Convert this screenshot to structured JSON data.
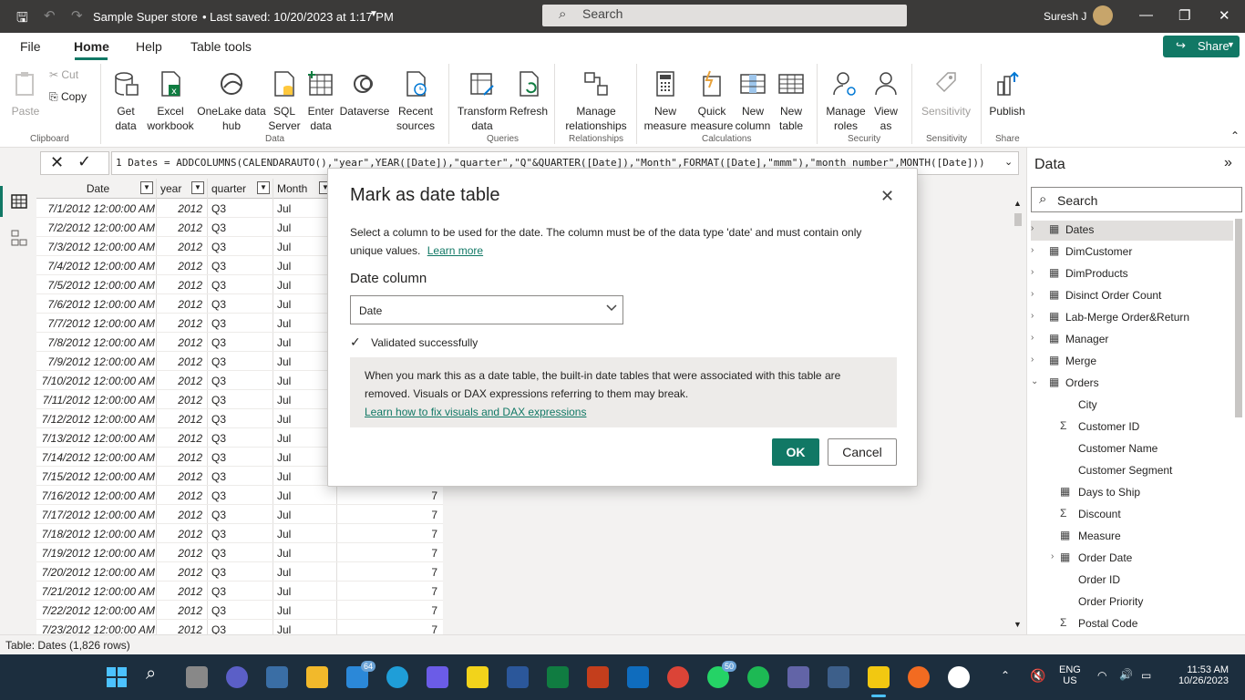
{
  "titlebar": {
    "title": "Sample Super store",
    "saved": "• Last saved: 10/20/2023 at 1:17 PM",
    "search_placeholder": "Search",
    "user": "Suresh J"
  },
  "menu": {
    "tabs": [
      "File",
      "Home",
      "Help",
      "Table tools"
    ],
    "active": "Home",
    "share_label": "Share"
  },
  "ribbon": {
    "clipboard": {
      "paste": "Paste",
      "cut": "Cut",
      "copy": "Copy",
      "group": "Clipboard"
    },
    "data": {
      "get_data": "Get data",
      "excel": "Excel workbook",
      "onelake": "OneLake data hub",
      "sql": "SQL Server",
      "enter": "Enter data",
      "dataverse": "Dataverse",
      "recent": "Recent sources",
      "group": "Data"
    },
    "queries": {
      "transform": "Transform data",
      "refresh": "Refresh",
      "group": "Queries"
    },
    "relationships": {
      "manage": "Manage relationships",
      "group": "Relationships"
    },
    "calculations": {
      "new_measure": "New measure",
      "quick_measure": "Quick measure",
      "new_column": "New column",
      "new_table": "New table",
      "group": "Calculations"
    },
    "security": {
      "manage_roles": "Manage roles",
      "view_as": "View as",
      "group": "Security"
    },
    "sensitivity": {
      "label": "Sensitivity",
      "group": "Sensitivity"
    },
    "share": {
      "publish": "Publish",
      "group": "Share"
    }
  },
  "formula": {
    "text": "1  Dates = ADDCOLUMNS(CALENDARAUTO(),\"year\",YEAR([Date]),\"quarter\",\"Q\"&QUARTER([Date]),\"Month\",FORMAT([Date],\"mmm\"),\"month number\",MONTH([Date]))"
  },
  "table": {
    "columns": [
      "Date",
      "year",
      "quarter",
      "Month"
    ],
    "rows": [
      [
        "7/1/2012 12:00:00 AM",
        "2012",
        "Q3",
        "Jul",
        ""
      ],
      [
        "7/2/2012 12:00:00 AM",
        "2012",
        "Q3",
        "Jul",
        ""
      ],
      [
        "7/3/2012 12:00:00 AM",
        "2012",
        "Q3",
        "Jul",
        ""
      ],
      [
        "7/4/2012 12:00:00 AM",
        "2012",
        "Q3",
        "Jul",
        ""
      ],
      [
        "7/5/2012 12:00:00 AM",
        "2012",
        "Q3",
        "Jul",
        ""
      ],
      [
        "7/6/2012 12:00:00 AM",
        "2012",
        "Q3",
        "Jul",
        ""
      ],
      [
        "7/7/2012 12:00:00 AM",
        "2012",
        "Q3",
        "Jul",
        ""
      ],
      [
        "7/8/2012 12:00:00 AM",
        "2012",
        "Q3",
        "Jul",
        ""
      ],
      [
        "7/9/2012 12:00:00 AM",
        "2012",
        "Q3",
        "Jul",
        ""
      ],
      [
        "7/10/2012 12:00:00 AM",
        "2012",
        "Q3",
        "Jul",
        ""
      ],
      [
        "7/11/2012 12:00:00 AM",
        "2012",
        "Q3",
        "Jul",
        ""
      ],
      [
        "7/12/2012 12:00:00 AM",
        "2012",
        "Q3",
        "Jul",
        ""
      ],
      [
        "7/13/2012 12:00:00 AM",
        "2012",
        "Q3",
        "Jul",
        ""
      ],
      [
        "7/14/2012 12:00:00 AM",
        "2012",
        "Q3",
        "Jul",
        ""
      ],
      [
        "7/15/2012 12:00:00 AM",
        "2012",
        "Q3",
        "Jul",
        ""
      ],
      [
        "7/16/2012 12:00:00 AM",
        "2012",
        "Q3",
        "Jul",
        "7"
      ],
      [
        "7/17/2012 12:00:00 AM",
        "2012",
        "Q3",
        "Jul",
        "7"
      ],
      [
        "7/18/2012 12:00:00 AM",
        "2012",
        "Q3",
        "Jul",
        "7"
      ],
      [
        "7/19/2012 12:00:00 AM",
        "2012",
        "Q3",
        "Jul",
        "7"
      ],
      [
        "7/20/2012 12:00:00 AM",
        "2012",
        "Q3",
        "Jul",
        "7"
      ],
      [
        "7/21/2012 12:00:00 AM",
        "2012",
        "Q3",
        "Jul",
        "7"
      ],
      [
        "7/22/2012 12:00:00 AM",
        "2012",
        "Q3",
        "Jul",
        "7"
      ],
      [
        "7/23/2012 12:00:00 AM",
        "2012",
        "Q3",
        "Jul",
        "7"
      ]
    ]
  },
  "modal": {
    "title": "Mark as date table",
    "description": "Select a column to be used for the date. The column must be of the data type 'date' and must contain only unique values.",
    "learn_more": "Learn more",
    "date_column_label": "Date column",
    "date_column_value": "Date",
    "validated": "Validated successfully",
    "warning": "When you mark this as a date table, the built-in date tables that were associated with this table are removed. Visuals or DAX expressions referring to them may break.",
    "warning_link": "Learn how to fix visuals and DAX expressions",
    "ok": "OK",
    "cancel": "Cancel"
  },
  "datapane": {
    "title": "Data",
    "search_placeholder": "Search",
    "tables": [
      "Dates",
      "DimCustomer",
      "DimProducts",
      "Disinct Order Count",
      "Lab-Merge Order&Return",
      "Manager",
      "Merge",
      "Orders"
    ],
    "fields": [
      "City",
      "Customer ID",
      "Customer Name",
      "Customer Segment",
      "Days to Ship",
      "Discount",
      "Measure",
      "Order Date",
      "Order ID",
      "Order Priority",
      "Postal Code"
    ]
  },
  "status": {
    "text": "Table: Dates (1,826 rows)"
  },
  "taskbar": {
    "mail_badge": "64",
    "whatsapp_badge": "50",
    "lang1": "ENG",
    "lang2": "US",
    "time": "11:53 AM",
    "date": "10/26/2023"
  }
}
